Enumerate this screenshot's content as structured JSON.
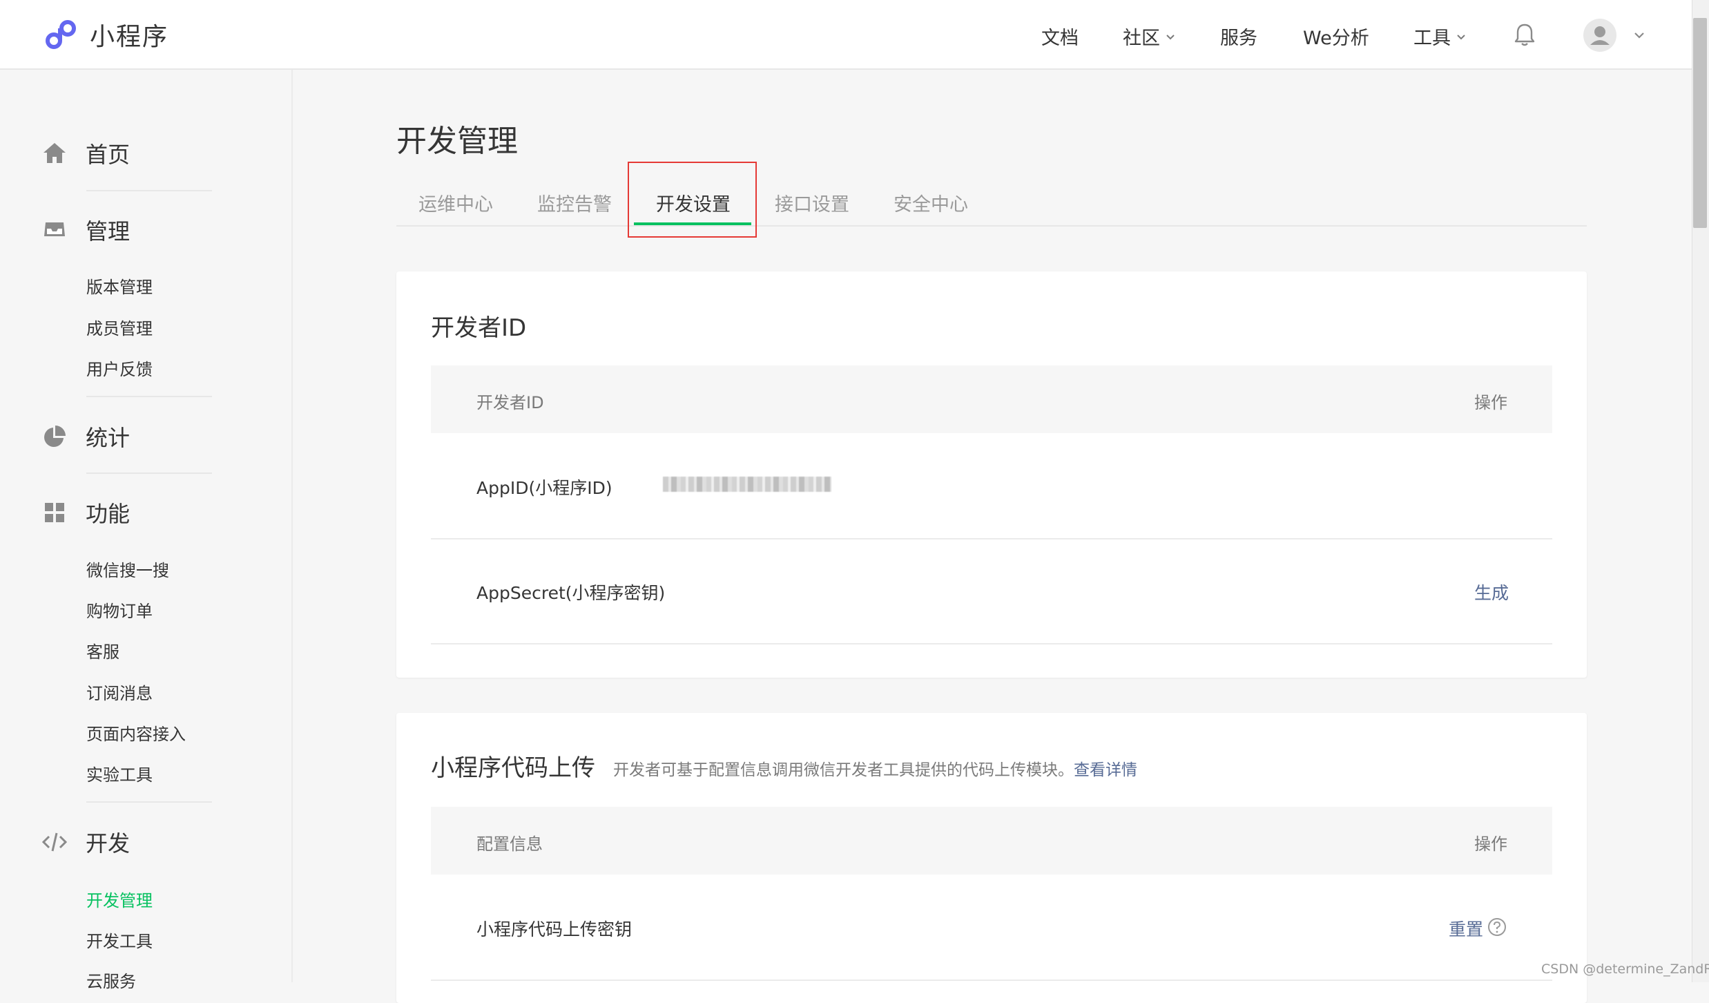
{
  "header": {
    "app_name": "小程序",
    "nav": [
      "文档",
      "社区",
      "服务",
      "We分析",
      "工具"
    ]
  },
  "sidebar": {
    "sections": [
      {
        "label": "首页",
        "icon": "home-icon"
      },
      {
        "label": "管理",
        "icon": "inbox-icon",
        "items": [
          "版本管理",
          "成员管理",
          "用户反馈"
        ]
      },
      {
        "label": "统计",
        "icon": "pie-chart-icon"
      },
      {
        "label": "功能",
        "icon": "grid-icon",
        "items": [
          "微信搜一搜",
          "购物订单",
          "客服",
          "订阅消息",
          "页面内容接入",
          "实验工具"
        ]
      },
      {
        "label": "开发",
        "icon": "code-icon",
        "items": [
          "开发管理",
          "开发工具",
          "云服务"
        ],
        "active_item": "开发管理"
      }
    ]
  },
  "main": {
    "title": "开发管理",
    "tabs": [
      "运维中心",
      "监控告警",
      "开发设置",
      "接口设置",
      "安全中心"
    ],
    "active_tab": "开发设置",
    "developer_id": {
      "title": "开发者ID",
      "columns": [
        "开发者ID",
        "操作"
      ],
      "rows": [
        {
          "label": "AppID(小程序ID)",
          "value": "",
          "action": ""
        },
        {
          "label": "AppSecret(小程序密钥)",
          "value": "",
          "action": "生成"
        }
      ]
    },
    "code_upload": {
      "title": "小程序代码上传",
      "desc": "开发者可基于配置信息调用微信开发者工具提供的代码上传模块。",
      "desc_link": "查看详情",
      "columns": [
        "配置信息",
        "操作"
      ],
      "rows": [
        {
          "label": "小程序代码上传密钥",
          "action": "重置"
        }
      ]
    }
  },
  "watermark": "CSDN @determine_ZandR",
  "colors": {
    "accent_green": "#07c160",
    "link_blue": "#576b95",
    "highlight_red": "#e53935",
    "logo_purple": "#6467f0"
  }
}
